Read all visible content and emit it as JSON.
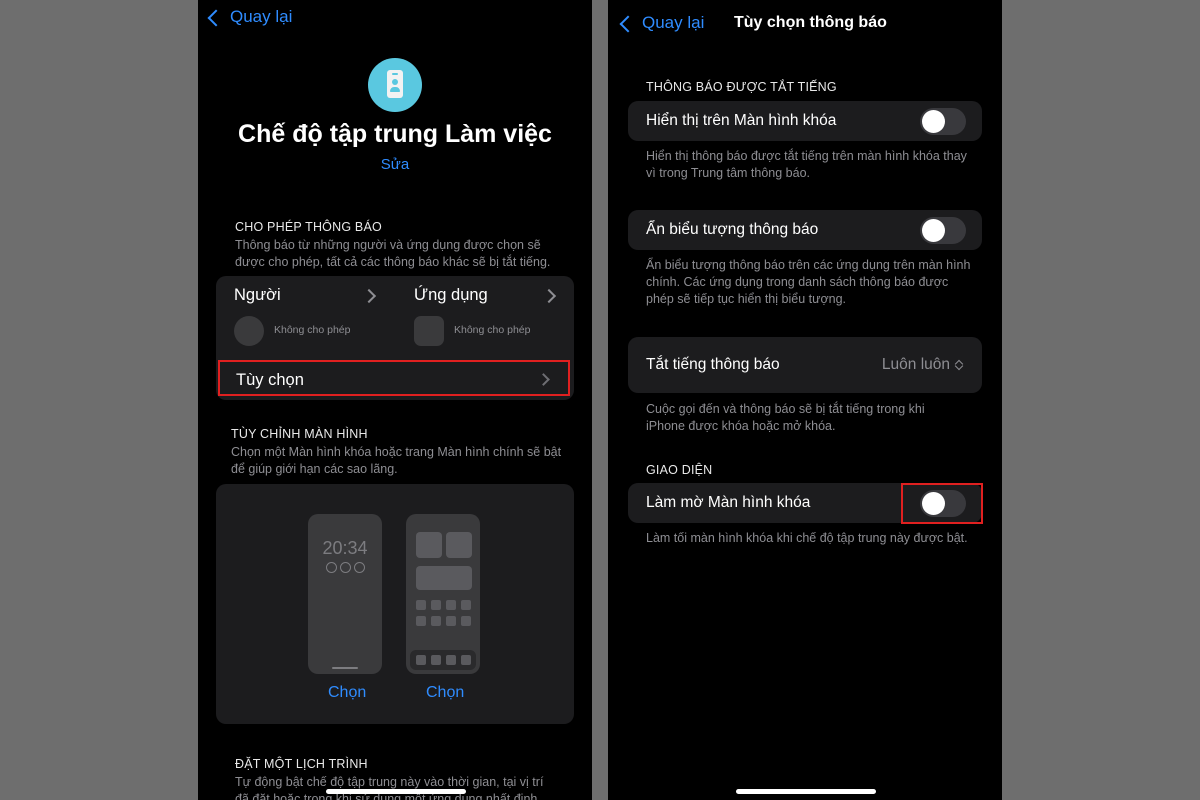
{
  "left_screen": {
    "back_label": "Quay lại",
    "title": "Chế độ tập trung Làm việc",
    "edit_label": "Sửa",
    "allow_section": {
      "heading": "CHO PHÉP THÔNG BÁO",
      "desc_line1": "Thông báo từ những người và ứng dụng được chọn sẽ",
      "desc_line2": "được cho phép, tất cả các thông báo khác sẽ bị tắt tiếng.",
      "people_label": "Người",
      "people_status": "Không cho phép",
      "apps_label": "Ứng dụng",
      "apps_status": "Không cho phép",
      "options_label": "Tùy chọn"
    },
    "screens_section": {
      "heading": "TÙY CHỈNH MÀN HÌNH",
      "desc_line1": "Chọn một Màn hình khóa hoặc trang Màn hình chính sẽ bật",
      "desc_line2": "để giúp giới hạn các sao lãng.",
      "lock_time": "20:34",
      "choose_lock": "Chọn",
      "choose_home": "Chọn"
    },
    "schedule_section": {
      "heading": "ĐẶT MỘT LỊCH TRÌNH",
      "desc_line1": "Tự động bật chế độ tập trung này vào thời gian, tại vị trí",
      "desc_line2": "đã đặt hoặc trong khi sử dụng một ứng dụng nhất định."
    }
  },
  "right_screen": {
    "back_label": "Quay lại",
    "nav_title": "Tùy chọn thông báo",
    "silenced_heading": "THÔNG BÁO ĐƯỢC TẮT TIẾNG",
    "show_on_lock": {
      "label": "Hiển thị trên Màn hình khóa",
      "enabled": false,
      "desc_line1": "Hiển thị thông báo được tắt tiếng trên màn hình khóa thay",
      "desc_line2": "vì trong Trung tâm thông báo."
    },
    "hide_badges": {
      "label": "Ẩn biểu tượng thông báo",
      "enabled": false,
      "desc_line1": "Ẩn biểu tượng thông báo trên các ứng dụng trên màn hình",
      "desc_line2": "chính. Các ứng dụng trong danh sách thông báo được",
      "desc_line3": "phép sẽ tiếp tục hiển thị biểu tượng."
    },
    "silence": {
      "label": "Tắt tiếng thông báo",
      "value": "Luôn luôn",
      "desc_line1": "Cuộc gọi đến và thông báo sẽ bị tắt tiếng trong khi",
      "desc_line2": "iPhone được khóa hoặc mở khóa."
    },
    "appearance_heading": "GIAO DIỆN",
    "dim_lock": {
      "label": "Làm mờ Màn hình khóa",
      "enabled": false,
      "desc": "Làm tối màn hình khóa khi chế độ tập trung này được bật."
    }
  },
  "colors": {
    "accent": "#2f8cff",
    "highlight_box": "#e02020",
    "focus_icon": "#5ac8e0"
  }
}
